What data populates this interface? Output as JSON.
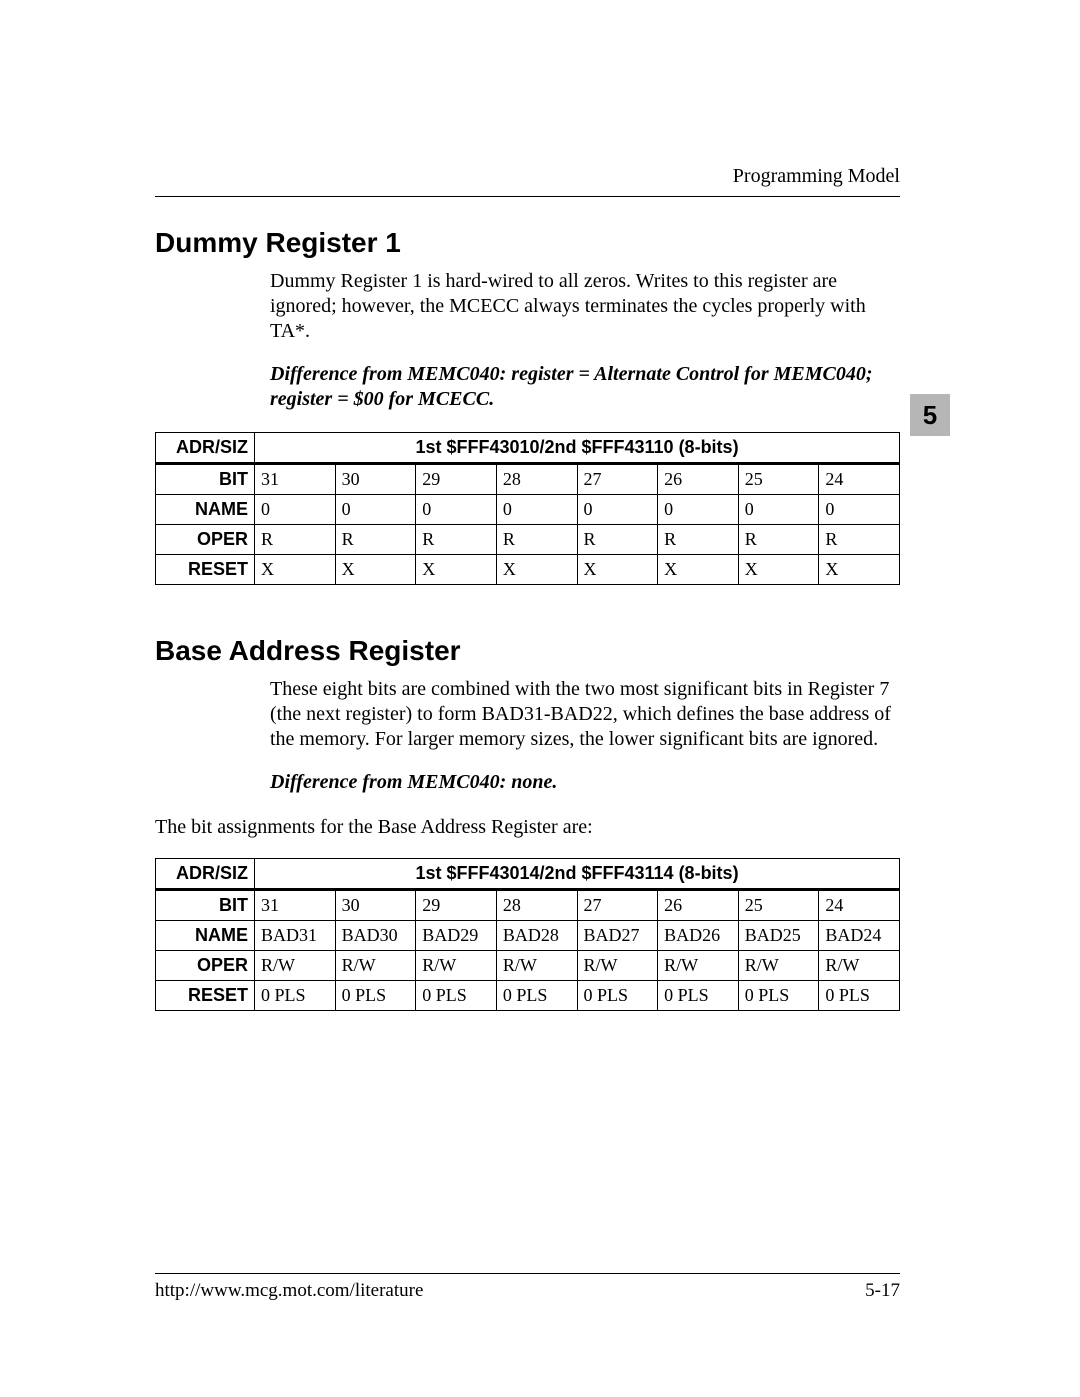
{
  "runningHead": "Programming Model",
  "chapterTab": "5",
  "footer": {
    "url": "http://www.mcg.mot.com/literature",
    "page": "5-17"
  },
  "section1": {
    "title": "Dummy Register 1",
    "para": "Dummy Register 1 is hard-wired to all zeros. Writes to this register are ignored; however, the MCECC always terminates the cycles properly with TA*.",
    "diff": "Difference from MEMC040:  register = Alternate Control for MEMC040; register = $00 for MCECC.",
    "table": {
      "rowLabels": {
        "adr": "ADR/SIZ",
        "bit": "BIT",
        "name": "NAME",
        "oper": "OPER",
        "reset": "RESET"
      },
      "adr": "1st $FFF43010/2nd $FFF43110 (8-bits)",
      "bit": [
        "31",
        "30",
        "29",
        "28",
        "27",
        "26",
        "25",
        "24"
      ],
      "name": [
        "0",
        "0",
        "0",
        "0",
        "0",
        "0",
        "0",
        "0"
      ],
      "oper": [
        "R",
        "R",
        "R",
        "R",
        "R",
        "R",
        "R",
        "R"
      ],
      "reset": [
        "X",
        "X",
        "X",
        "X",
        "X",
        "X",
        "X",
        "X"
      ]
    }
  },
  "section2": {
    "title": "Base Address Register",
    "para": "These eight bits are combined with the two most significant bits in Register 7 (the next register) to form BAD31-BAD22, which defines the base address of the memory. For larger memory sizes, the lower significant bits are ignored.",
    "diff": "Difference from MEMC040:  none.",
    "para2": "The bit assignments for the Base Address Register are:",
    "table": {
      "rowLabels": {
        "adr": "ADR/SIZ",
        "bit": "BIT",
        "name": "NAME",
        "oper": "OPER",
        "reset": "RESET"
      },
      "adr": "1st $FFF43014/2nd $FFF43114 (8-bits)",
      "bit": [
        "31",
        "30",
        "29",
        "28",
        "27",
        "26",
        "25",
        "24"
      ],
      "name": [
        "BAD31",
        "BAD30",
        "BAD29",
        "BAD28",
        "BAD27",
        "BAD26",
        "BAD25",
        "BAD24"
      ],
      "oper": [
        "R/W",
        "R/W",
        "R/W",
        "R/W",
        "R/W",
        "R/W",
        "R/W",
        "R/W"
      ],
      "reset": [
        "0 PLS",
        "0 PLS",
        "0 PLS",
        "0 PLS",
        "0 PLS",
        "0 PLS",
        "0 PLS",
        "0 PLS"
      ]
    }
  }
}
